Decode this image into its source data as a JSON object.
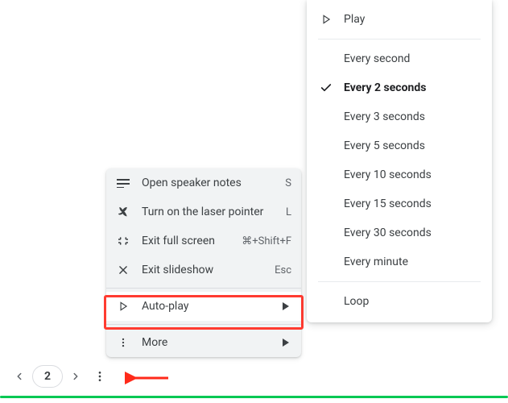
{
  "bottom_bar": {
    "page_number": "2"
  },
  "menu": {
    "items": [
      {
        "label": "Open speaker notes",
        "shortcut": "S"
      },
      {
        "label": "Turn on the laser pointer",
        "shortcut": "L"
      },
      {
        "label": "Exit full screen",
        "shortcut": "⌘+Shift+F"
      },
      {
        "label": "Exit slideshow",
        "shortcut": "Esc"
      }
    ],
    "autoplay_label": "Auto-play",
    "more_label": "More"
  },
  "submenu": {
    "play_label": "Play",
    "intervals": [
      "Every second",
      "Every 2 seconds",
      "Every 3 seconds",
      "Every 5 seconds",
      "Every 10 seconds",
      "Every 15 seconds",
      "Every 30 seconds",
      "Every minute"
    ],
    "selected_index": 1,
    "loop_label": "Loop"
  },
  "colors": {
    "accent_green": "#00c853",
    "highlight_red": "#ff3b30"
  }
}
